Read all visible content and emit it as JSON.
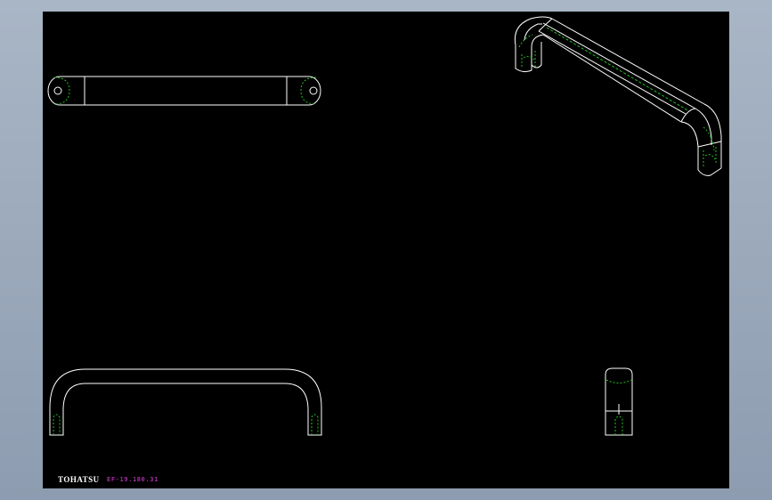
{
  "title_block": {
    "brand": "TOHATSU",
    "part_number": "EF-19.180.31"
  },
  "colors": {
    "background": "#9aa8ba",
    "sheet": "#000000",
    "outline": "#ffffff",
    "hidden_line": "#22c022",
    "part_number_text": "#e040e0"
  }
}
